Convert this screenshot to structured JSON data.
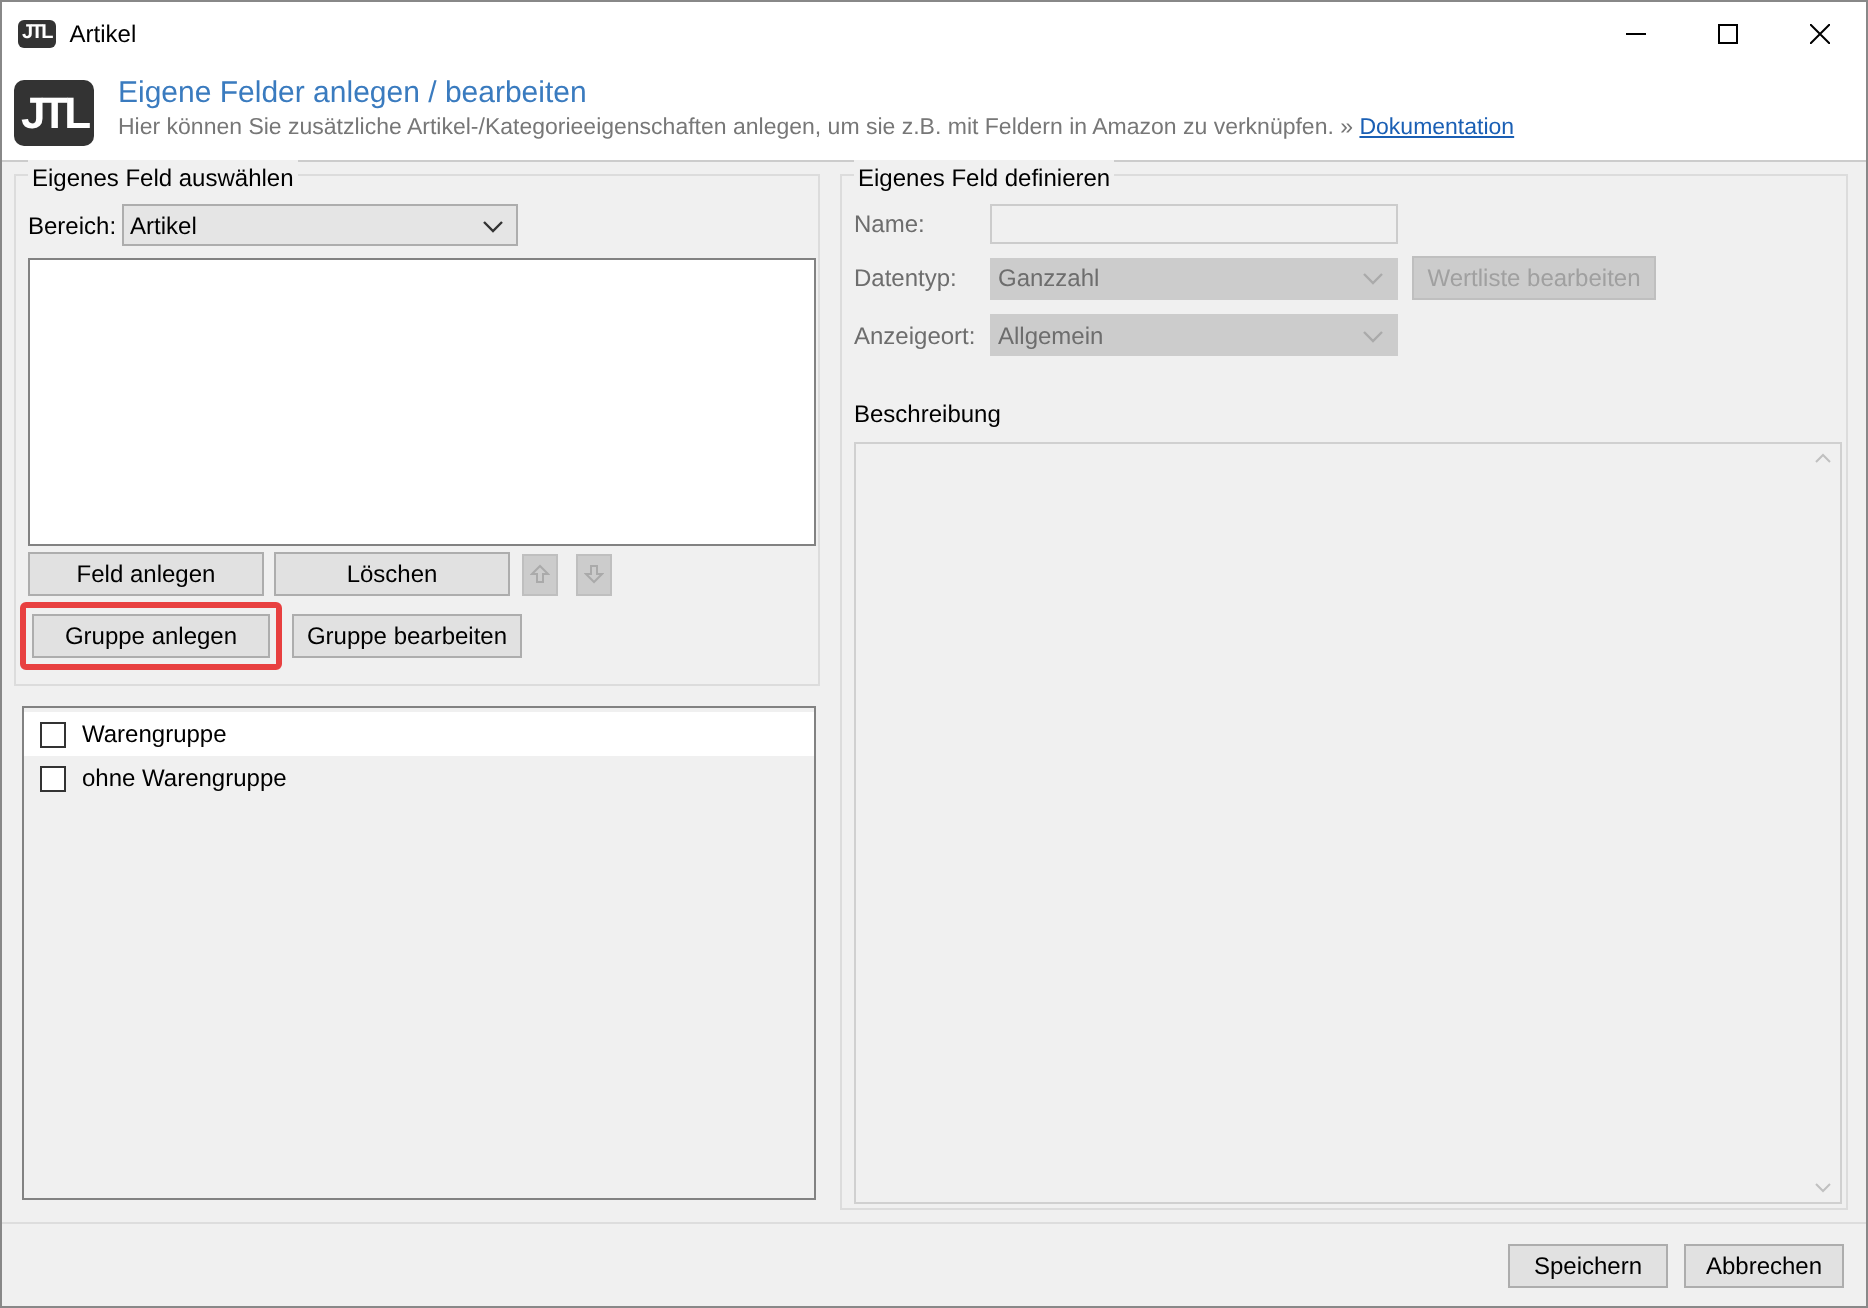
{
  "window": {
    "title": "Artikel",
    "logo": "JTL"
  },
  "header": {
    "logo": "JTL",
    "title": "Eigene Felder anlegen / bearbeiten",
    "description": "Hier können Sie zusätzliche Artikel-/Kategorieeigenschaften anlegen, um sie z.B. mit Feldern in Amazon zu verknüpfen.",
    "link_prefix": "»",
    "link": "Dokumentation"
  },
  "select_group": {
    "legend": "Eigenes Feld auswählen",
    "bereich_label": "Bereich:",
    "bereich_value": "Artikel",
    "buttons": [
      {
        "label": "Feld anlegen",
        "highlighted": false
      },
      {
        "label": "Löschen",
        "highlighted": false
      }
    ],
    "move_buttons": [
      {
        "kind": "up",
        "disabled": true
      },
      {
        "kind": "down",
        "disabled": true
      }
    ],
    "group_buttons": [
      {
        "label": "Gruppe anlegen",
        "highlighted": true
      },
      {
        "label": "Gruppe bearbeiten",
        "highlighted": false
      }
    ]
  },
  "groups": [
    {
      "label": "Warengruppe",
      "checked": false,
      "selected": true
    },
    {
      "label": "ohne Warengruppe",
      "checked": false,
      "selected": false
    }
  ],
  "define_group": {
    "legend": "Eigenes Feld definieren",
    "disabled": true,
    "name_label": "Name:",
    "datentyp_label": "Datentyp:",
    "datentyp_value": "Ganzzahl",
    "wertliste_button": "Wertliste bearbeiten",
    "anzeigeort_label": "Anzeigeort:",
    "anzeigeort_value": "Allgemein",
    "beschreibung_label": "Beschreibung"
  },
  "footer": {
    "buttons": [
      "Speichern",
      "Abbrechen"
    ]
  }
}
